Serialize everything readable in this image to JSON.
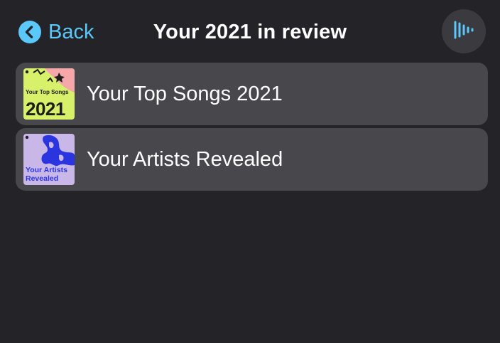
{
  "header": {
    "back_label": "Back",
    "title": "Your 2021 in review",
    "now_playing_icon": "now-playing-waveform-icon"
  },
  "colors": {
    "accent": "#5ac8fa",
    "background": "#242428",
    "row_background": "#48484c"
  },
  "list": {
    "items": [
      {
        "label": "Your Top Songs 2021",
        "art_caption": "Your Top Songs",
        "art_year": "2021",
        "art_colors": {
          "bg": "#d7f26a",
          "pink": "#f6a7a9",
          "ink": "#1e1e1e"
        }
      },
      {
        "label": "Your Artists Revealed",
        "art_caption_line1": "Your Artists",
        "art_caption_line2": "Revealed",
        "art_colors": {
          "bg": "#c9b7e8",
          "blue": "#2a35e0",
          "ink": "#2a35e0"
        }
      }
    ]
  }
}
